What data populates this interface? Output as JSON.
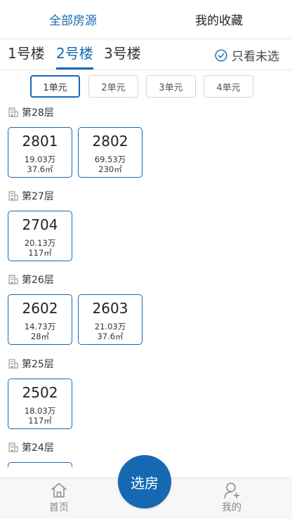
{
  "top_tabs": {
    "all_listings": "全部房源",
    "favorites": "我的收藏"
  },
  "buildings": {
    "items": [
      "1号楼",
      "2号楼",
      "3号楼"
    ],
    "active_index": 1,
    "unselected_filter_label": "只看未选"
  },
  "units": {
    "items": [
      "1单元",
      "2单元",
      "3单元",
      "4单元"
    ],
    "active_index": 0
  },
  "floors": [
    {
      "label": "第28层",
      "rooms": [
        {
          "number": "2801",
          "price": "19.03万",
          "area": "37.6㎡"
        },
        {
          "number": "2802",
          "price": "69.53万",
          "area": "230㎡"
        }
      ]
    },
    {
      "label": "第27层",
      "rooms": [
        {
          "number": "2704",
          "price": "20.13万",
          "area": "117㎡"
        }
      ]
    },
    {
      "label": "第26层",
      "rooms": [
        {
          "number": "2602",
          "price": "14.73万",
          "area": "28㎡"
        },
        {
          "number": "2603",
          "price": "21.03万",
          "area": "37.6㎡"
        }
      ]
    },
    {
      "label": "第25层",
      "rooms": [
        {
          "number": "2502",
          "price": "18.03万",
          "area": "117㎡"
        }
      ]
    },
    {
      "label": "第24层",
      "rooms": [
        {
          "number": "",
          "price": "",
          "area": ""
        }
      ]
    }
  ],
  "bottom_nav": {
    "home_label": "首页",
    "select_label": "选房",
    "mine_label": "我的"
  },
  "colors": {
    "accent": "#1768b3",
    "text": "#333333",
    "muted": "#8a8a8a",
    "border": "#d6d6d6"
  },
  "icons": {
    "filter": "check-circle-icon",
    "floor": "building-icon",
    "home": "home-icon",
    "mine": "user-add-icon"
  }
}
